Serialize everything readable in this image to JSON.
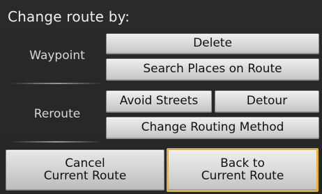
{
  "title": "Change route by:",
  "waypoint": {
    "label": "Waypoint",
    "delete_label": "Delete",
    "search_label": "Search Places on Route"
  },
  "reroute": {
    "label": "Reroute",
    "avoid_label": "Avoid Streets",
    "detour_label": "Detour",
    "change_method_label": "Change Routing Method"
  },
  "bottom": {
    "cancel_label": "Cancel\nCurrent Route",
    "back_label": "Back to\nCurrent Route"
  },
  "colors": {
    "selected_border": "#e8b23a"
  }
}
